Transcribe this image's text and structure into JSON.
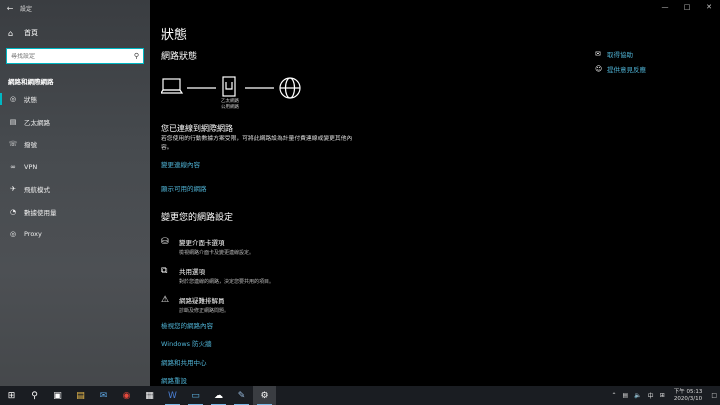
{
  "window": {
    "title": "設定"
  },
  "sidebar": {
    "home_label": "首頁",
    "search_placeholder": "尋找設定",
    "section_title": "網路和網際網路",
    "items": [
      {
        "label": "狀態",
        "icon": "globe-icon"
      },
      {
        "label": "乙太網路",
        "icon": "ethernet-icon"
      },
      {
        "label": "撥號",
        "icon": "phone-icon"
      },
      {
        "label": "VPN",
        "icon": "vpn-icon"
      },
      {
        "label": "飛航模式",
        "icon": "airplane-icon"
      },
      {
        "label": "數據使用量",
        "icon": "data-usage-icon"
      },
      {
        "label": "Proxy",
        "icon": "globe-icon"
      }
    ]
  },
  "main": {
    "title": "狀態",
    "network_status_heading": "網路狀態",
    "diagram_label_line1": "乙太網路",
    "diagram_label_line2": "公用網路",
    "connected_text": "您已連線到網際網路",
    "description": "若您使用的行動數據方案受限，可將此網路設為計量付費連線或變更其他內容。",
    "link_change_props": "變更連線內容",
    "link_show_networks": "顯示可用的網路",
    "change_settings_heading": "變更您的網路設定",
    "options": [
      {
        "title": "變更介面卡選項",
        "desc": "檢視網路介面卡及變更連線設定。",
        "icon": "adapter-icon"
      },
      {
        "title": "共用選項",
        "desc": "對於您連線的網路，決定您要共用的項目。",
        "icon": "sharing-icon"
      },
      {
        "title": "網路疑難排解員",
        "desc": "診斷及修正網路問題。",
        "icon": "warning-icon"
      }
    ],
    "bottom_links": [
      "檢視您的網路內容",
      "Windows 防火牆",
      "網路和共用中心",
      "網路重設"
    ]
  },
  "right_links": [
    {
      "label": "取得協助",
      "icon": "help-icon"
    },
    {
      "label": "提供意見反應",
      "icon": "feedback-icon"
    }
  ],
  "taskbar": {
    "tray_ime": "中",
    "time": "下午 05:13",
    "date": "2020/3/10"
  },
  "colors": {
    "accent": "#00b7c3",
    "link": "#4fb2d4"
  }
}
